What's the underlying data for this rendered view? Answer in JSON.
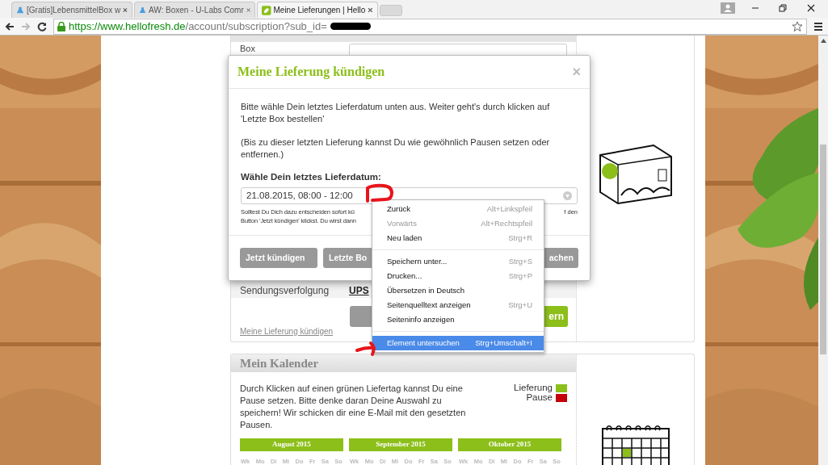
{
  "browser": {
    "tabs": [
      {
        "title": "[Gratis]LebensmittelBox w",
        "selected": false
      },
      {
        "title": "AW: Boxen - U-Labs Comr",
        "selected": false
      },
      {
        "title": "Meine Lieferungen | Hello",
        "selected": true
      }
    ],
    "url": {
      "host": "https://www.hellofresh.de",
      "path": "/account/subscription?sub_id="
    }
  },
  "subscription": {
    "box_label": "Box",
    "tracking_label": "Sendungsverfolgung",
    "tracking_value": "UPS",
    "save_button": "ern",
    "cancel_link": "Meine Lieferung kündigen"
  },
  "modal": {
    "title": "Meine Lieferung kündigen",
    "close": "×",
    "paragraphs": [
      "Bitte wähle Dein letztes Lieferdatum unten aus. Weiter geht's durch klicken auf 'Letzte Box bestellen'",
      "(Bis zu dieser letzten Lieferung kannst Du wie gewöhnlich Pausen setzen oder entfernen.)"
    ],
    "date_label": "Wähle Dein letztes Lieferdatum:",
    "date_value": "21.08.2015, 08:00 - 12:00",
    "hint_lines": [
      {
        "left": "Solltest Du Dich dazu entscheiden sofort kü",
        "right": "f den"
      },
      {
        "left": "Button 'Jetzt kündigen' klickst. Du wirst dann"
      }
    ],
    "buttons": [
      {
        "label": "Jetzt kündigen"
      },
      {
        "label": "Letzte Bo"
      },
      {
        "label": "achen"
      }
    ]
  },
  "context_menu": {
    "items": [
      {
        "kind": "item",
        "label": "Zurück",
        "shortcut": "Alt+Linkspfeil",
        "disabled": false,
        "selected": false
      },
      {
        "kind": "item",
        "label": "Vorwärts",
        "shortcut": "Alt+Rechtspfeil",
        "disabled": true,
        "selected": false
      },
      {
        "kind": "item",
        "label": "Neu laden",
        "shortcut": "Strg+R",
        "disabled": false,
        "selected": false
      },
      {
        "kind": "separator"
      },
      {
        "kind": "item",
        "label": "Speichern unter...",
        "shortcut": "Strg+S",
        "disabled": false,
        "selected": false
      },
      {
        "kind": "item",
        "label": "Drucken...",
        "shortcut": "Strg+P",
        "disabled": false,
        "selected": false
      },
      {
        "kind": "item",
        "label": "Übersetzen in Deutsch",
        "disabled": false,
        "selected": false
      },
      {
        "kind": "item",
        "label": "Seitenquelltext anzeigen",
        "shortcut": "Strg+U",
        "disabled": false,
        "selected": false
      },
      {
        "kind": "item",
        "label": "Seiteninfo anzeigen",
        "disabled": false,
        "selected": false
      },
      {
        "kind": "separator"
      },
      {
        "kind": "item",
        "label": "Element untersuchen",
        "shortcut": "Strg+Umschalt+I",
        "disabled": false,
        "selected": true
      }
    ]
  },
  "calendar": {
    "title": "Mein Kalender",
    "text": "Durch Klicken auf einen grünen Liefertag kannst Du eine Pause setzen. Bitte denke daran Deine Auswahl zu speichern! Wir schicken dir eine E-Mail mit den gesetzten Pausen.",
    "legend": [
      {
        "label": "Lieferung",
        "color": "#8cbf1a"
      },
      {
        "label": "Pause",
        "color": "#c4000b"
      }
    ],
    "months": [
      {
        "name": "August 2015",
        "weekdays": [
          "Wk",
          "Mo",
          "Di",
          "Mi",
          "Do",
          "Fr",
          "Sa",
          "So"
        ]
      },
      {
        "name": "September 2015",
        "weekdays": [
          "Wk",
          "Mo",
          "Di",
          "Mi",
          "Do",
          "Fr",
          "Sa",
          "So"
        ]
      },
      {
        "name": "Oktober 2015",
        "weekdays": [
          "Wk",
          "Mo",
          "Di",
          "Mi",
          "Do",
          "Fr",
          "Sa",
          "So"
        ]
      }
    ]
  }
}
